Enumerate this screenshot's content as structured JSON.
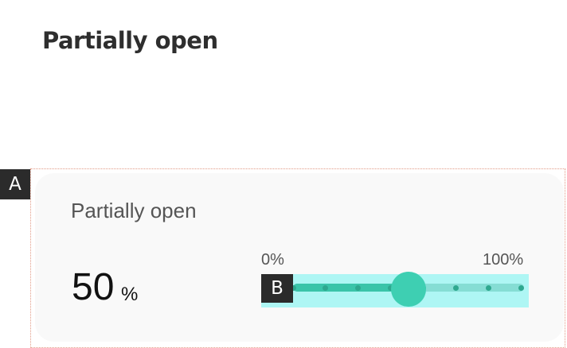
{
  "page": {
    "title": "Partially open"
  },
  "annotations": {
    "a": "A",
    "b": "B"
  },
  "card": {
    "title": "Partially open",
    "value": "50",
    "unit": "%",
    "slider": {
      "min_label": "0%",
      "max_label": "100%",
      "value_fraction": 0.5,
      "tick_count": 8,
      "colors": {
        "area": "#aef6f4",
        "track": "#85ddd4",
        "fill": "#3ac4a9",
        "thumb": "#3ecfb2"
      }
    }
  }
}
